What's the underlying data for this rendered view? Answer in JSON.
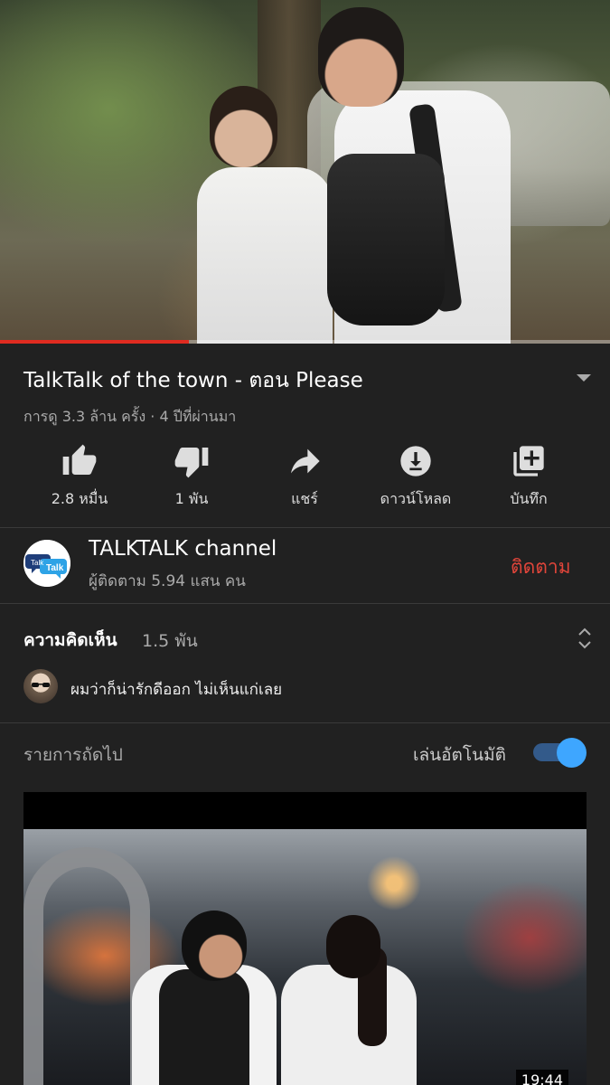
{
  "video": {
    "progress_fraction": 0.31,
    "title": "TalkTalk of the town - ตอน Please",
    "meta": "การดู 3.3 ล้าน ครั้ง · 4 ปีที่ผ่านมา"
  },
  "actions": [
    {
      "icon": "thumbs-up-icon",
      "label": "2.8 หมื่น"
    },
    {
      "icon": "thumbs-down-icon",
      "label": "1 พัน"
    },
    {
      "icon": "share-icon",
      "label": "แชร์"
    },
    {
      "icon": "download-icon",
      "label": "ดาวน์โหลด"
    },
    {
      "icon": "save-to-playlist-icon",
      "label": "บันทึก"
    }
  ],
  "channel": {
    "logo_text_1": "Talk",
    "logo_text_2": "Talk",
    "name": "TALKTALK channel",
    "subscribers": "ผู้ติดตาม 5.94 แสน คน",
    "subscribe_label": "ติดตาม"
  },
  "comments": {
    "title": "ความคิดเห็น",
    "count": "1.5 พัน",
    "top_comment": "ผมว่าก็น่ารักดีออก ไม่เห็นแก่เลย"
  },
  "up_next": {
    "label": "รายการถัดไป",
    "autoplay_label": "เล่นอัตโนมัติ",
    "autoplay_on": true,
    "duration": "19:44"
  },
  "colors": {
    "background": "#212121",
    "progress": "#e02b20",
    "subscribe": "#e0453a",
    "autoplay_accent": "#3ea6ff"
  }
}
